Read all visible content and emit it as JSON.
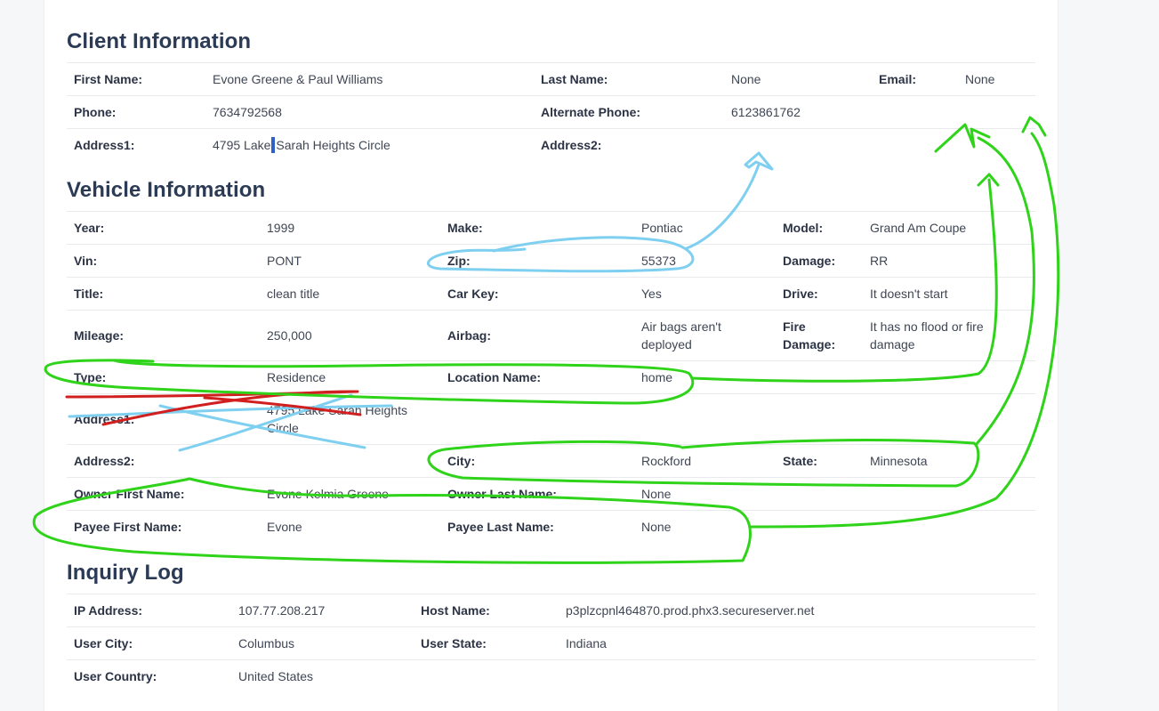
{
  "sections": {
    "client": "Client Information",
    "vehicle": "Vehicle Information",
    "inquiry": "Inquiry Log"
  },
  "client": {
    "first_name_label": "First Name:",
    "first_name": "Evone Greene & Paul Williams",
    "last_name_label": "Last Name:",
    "last_name": "None",
    "email_label": "Email:",
    "email": "None",
    "phone_label": "Phone:",
    "phone": "7634792568",
    "alt_phone_label": "Alternate Phone:",
    "alt_phone": "6123861762",
    "address1_label": "Address1:",
    "address1_before_cursor": "4795 Lake",
    "address1_after_cursor": "Sarah Heights Circle",
    "address2_label": "Address2:",
    "address2": ""
  },
  "vehicle": {
    "year_label": "Year:",
    "year": "1999",
    "make_label": "Make:",
    "make": "Pontiac",
    "model_label": "Model:",
    "model": "Grand Am Coupe",
    "vin_label": "Vin:",
    "vin": "PONT",
    "zip_label": "Zip:",
    "zip": "55373",
    "damage_label": "Damage:",
    "damage": "RR",
    "title_label": "Title:",
    "title": "clean title",
    "car_key_label": "Car Key:",
    "car_key": "Yes",
    "drive_label": "Drive:",
    "drive": "It doesn't start",
    "mileage_label": "Mileage:",
    "mileage": "250,000",
    "airbag_label": "Airbag:",
    "airbag": "Air bags aren't deployed",
    "fire_damage_label": "Fire Damage:",
    "fire_damage": "It has no flood or fire damage",
    "type_label": "Type:",
    "type": "Residence",
    "location_name_label": "Location Name:",
    "location_name": "home",
    "address1_label": "Address1:",
    "address1": "4795 Lake Sarah Heights Circle",
    "address2_label": "Address2:",
    "address2": "",
    "city_label": "City:",
    "city": "Rockford",
    "state_label": "State:",
    "state": "Minnesota",
    "owner_first_label": "Owner First Name:",
    "owner_first": "Evone Kelmia Greene",
    "owner_last_label": "Owner Last Name:",
    "owner_last": "None",
    "payee_first_label": "Payee First Name:",
    "payee_first": "Evone",
    "payee_last_label": "Payee Last Name:",
    "payee_last": "None"
  },
  "inquiry": {
    "ip_label": "IP Address:",
    "ip": "107.77.208.217",
    "host_label": "Host Name:",
    "host": "p3plzcpnl464870.prod.phx3.secureserver.net",
    "user_city_label": "User City:",
    "user_city": "Columbus",
    "user_state_label": "User State:",
    "user_state": "Indiana",
    "user_country_label": "User Country:",
    "user_country": "United States"
  },
  "annotation_colors": {
    "green": "#2fd31a",
    "blue": "#7fd0f0",
    "red": "#d11f1f",
    "cursor": "#2f5fc8"
  }
}
